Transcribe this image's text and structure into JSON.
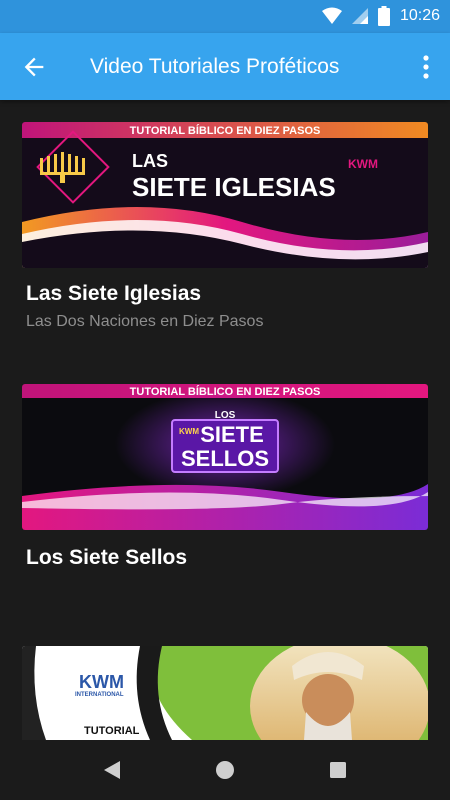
{
  "status": {
    "time": "10:26"
  },
  "appbar": {
    "title": "Video Tutoriales Proféticos"
  },
  "cards": [
    {
      "title": "Las Siete Iglesias",
      "subtitle": "Las Dos Naciones en Diez Pasos",
      "banner": {
        "top_text": "TUTORIAL BÍBLICO EN DIEZ PASOS",
        "line1": "LAS",
        "line2": "SIETE IGLESIAS",
        "logo": "KWM"
      }
    },
    {
      "title": "Los Siete Sellos",
      "banner": {
        "top_text": "TUTORIAL BÍBLICO EN DIEZ PASOS",
        "line1": "LOS",
        "line2": "SIETE",
        "line3": "SELLOS",
        "logo": "KWM"
      }
    },
    {
      "banner": {
        "logo": "KWM",
        "logo_sub": "INTERNATIONAL",
        "text": "TUTORIAL"
      }
    }
  ],
  "icons": {
    "back": "arrow-left-icon",
    "more": "more-vert-icon",
    "wifi": "wifi-icon",
    "signal": "signal-icon",
    "battery": "battery-icon",
    "nav_back": "triangle-back-icon",
    "nav_home": "circle-home-icon",
    "nav_recents": "square-recents-icon"
  },
  "colors": {
    "statusbar": "#2f93dc",
    "appbar": "#37a4ee",
    "background": "#1b1b1b",
    "accent_pink": "#e3177f",
    "accent_orange": "#f07d24",
    "accent_purple": "#8b2ad8",
    "accent_green": "#7fbf3b"
  }
}
